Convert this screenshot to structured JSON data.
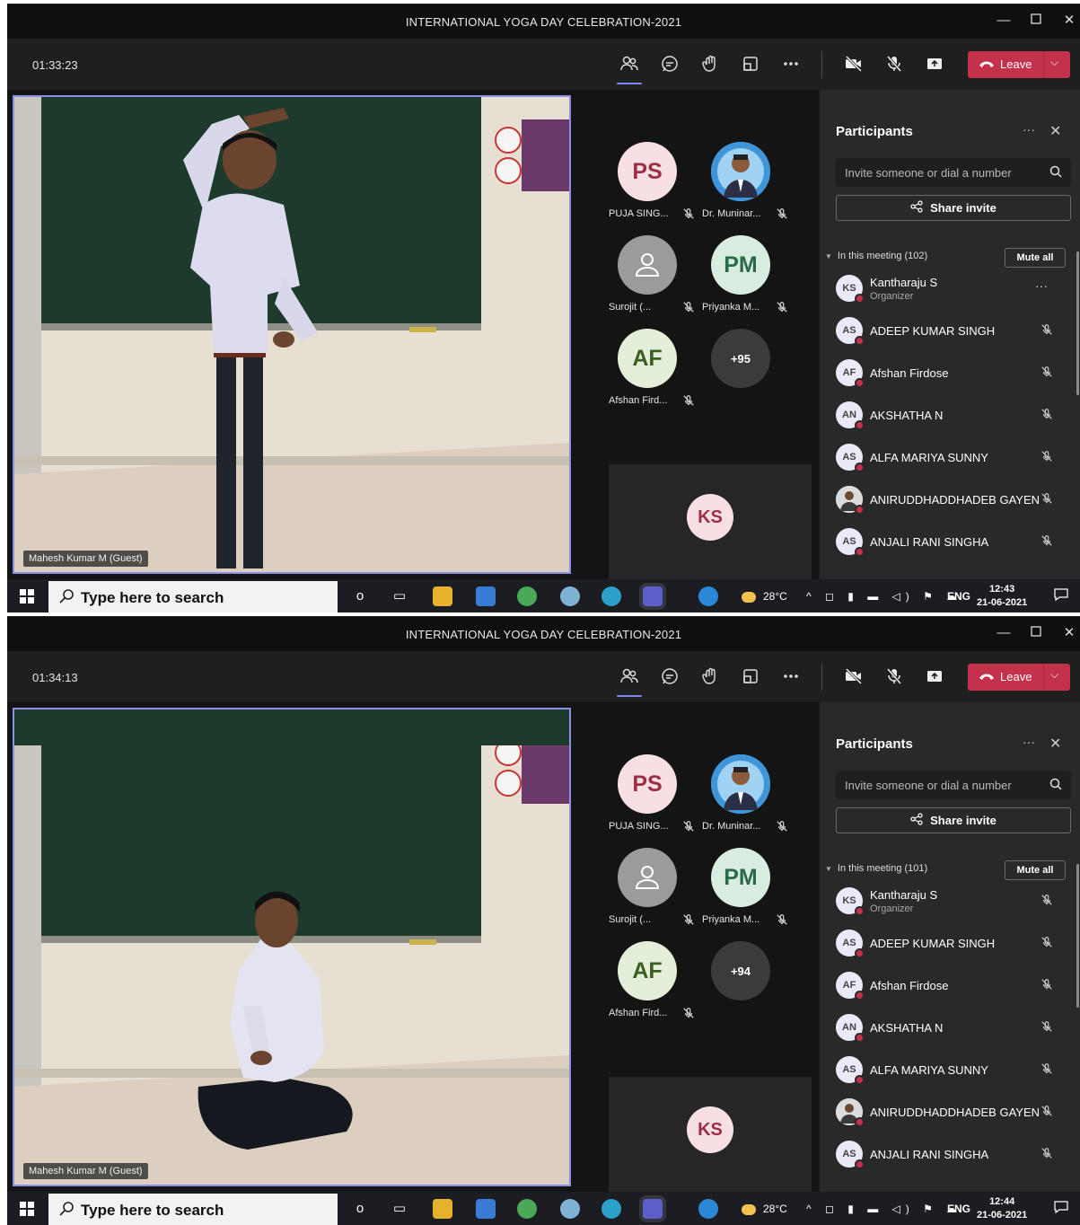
{
  "screens": [
    {
      "window_title": "INTERNATIONAL YOGA DAY CELEBRATION-2021",
      "timer": "01:33:23",
      "leave_label": "Leave",
      "pose": "standing",
      "video_name": "Mahesh Kumar M (Guest)",
      "tiles": [
        {
          "initials": "PS",
          "name": "PUJA SING...",
          "bg": "#f8dfe3",
          "fg": "#9d2f45"
        },
        {
          "initials": "",
          "name": "Dr. Muninar...",
          "photo": true
        },
        {
          "initials": "",
          "name": "Surojit (...",
          "generic": true
        },
        {
          "initials": "PM",
          "name": "Priyanka M...",
          "bg": "#d8ece0",
          "fg": "#2b6a47"
        },
        {
          "initials": "AF",
          "name": "Afshan Fird...",
          "bg": "#e4efd9",
          "fg": "#3d5e23"
        }
      ],
      "overflow_count": "+95",
      "self_initials": "KS",
      "panel": {
        "title": "Participants",
        "invite_placeholder": "Invite someone or dial a number",
        "share_label": "Share invite",
        "in_meeting": "In this meeting (102)",
        "mute_all": "Mute all",
        "organizer_dots": true,
        "people": [
          {
            "initials": "KS",
            "name": "Kantharaju S",
            "role": "Organizer"
          },
          {
            "initials": "AS",
            "name": "ADEEP KUMAR SINGH",
            "role": ""
          },
          {
            "initials": "AF",
            "name": "Afshan Firdose",
            "role": ""
          },
          {
            "initials": "AN",
            "name": "AKSHATHA N",
            "role": ""
          },
          {
            "initials": "AS",
            "name": "ALFA MARIYA SUNNY",
            "role": ""
          },
          {
            "initials": "",
            "name": "ANIRUDDHADDHADEB GAYEN",
            "role": "",
            "photo": true
          },
          {
            "initials": "AS",
            "name": "ANJALI RANI SINGHA",
            "role": ""
          }
        ]
      },
      "taskbar": {
        "search_placeholder": "Type here to search",
        "weather": "28°C",
        "lang": "ENG",
        "time": "12:43",
        "date": "21-06-2021"
      }
    },
    {
      "window_title": "INTERNATIONAL YOGA DAY CELEBRATION-2021",
      "timer": "01:34:13",
      "leave_label": "Leave",
      "pose": "kneeling",
      "video_name": "Mahesh Kumar M (Guest)",
      "tiles": [
        {
          "initials": "PS",
          "name": "PUJA SING...",
          "bg": "#f8dfe3",
          "fg": "#9d2f45"
        },
        {
          "initials": "",
          "name": "Dr. Muninar...",
          "photo": true
        },
        {
          "initials": "",
          "name": "Surojit (...",
          "generic": true
        },
        {
          "initials": "PM",
          "name": "Priyanka M...",
          "bg": "#d8ece0",
          "fg": "#2b6a47"
        },
        {
          "initials": "AF",
          "name": "Afshan Fird...",
          "bg": "#e4efd9",
          "fg": "#3d5e23"
        }
      ],
      "overflow_count": "+94",
      "self_initials": "KS",
      "panel": {
        "title": "Participants",
        "invite_placeholder": "Invite someone or dial a number",
        "share_label": "Share invite",
        "in_meeting": "In this meeting (101)",
        "mute_all": "Mute all",
        "organizer_dots": false,
        "people": [
          {
            "initials": "KS",
            "name": "Kantharaju S",
            "role": "Organizer"
          },
          {
            "initials": "AS",
            "name": "ADEEP KUMAR SINGH",
            "role": ""
          },
          {
            "initials": "AF",
            "name": "Afshan Firdose",
            "role": ""
          },
          {
            "initials": "AN",
            "name": "AKSHATHA N",
            "role": ""
          },
          {
            "initials": "AS",
            "name": "ALFA MARIYA SUNNY",
            "role": ""
          },
          {
            "initials": "",
            "name": "ANIRUDDHADDHADEB GAYEN",
            "role": "",
            "photo": true
          },
          {
            "initials": "AS",
            "name": "ANJALI RANI SINGHA",
            "role": ""
          }
        ]
      },
      "taskbar": {
        "search_placeholder": "Type here to search",
        "weather": "28°C",
        "lang": "ENG",
        "time": "12:44",
        "date": "21-06-2021"
      }
    }
  ],
  "colors": {
    "accent": "#7f85f5",
    "leave": "#c4314b",
    "panel_bg": "#292929",
    "stage_bg": "#141414"
  },
  "icons": [
    "people-icon",
    "chat-icon",
    "raise-hand-icon",
    "rooms-icon",
    "more-icon",
    "camera-off-icon",
    "mic-off-icon",
    "share-tray-icon",
    "phone-icon",
    "search-icon",
    "share-icon",
    "windows-start-icon"
  ]
}
